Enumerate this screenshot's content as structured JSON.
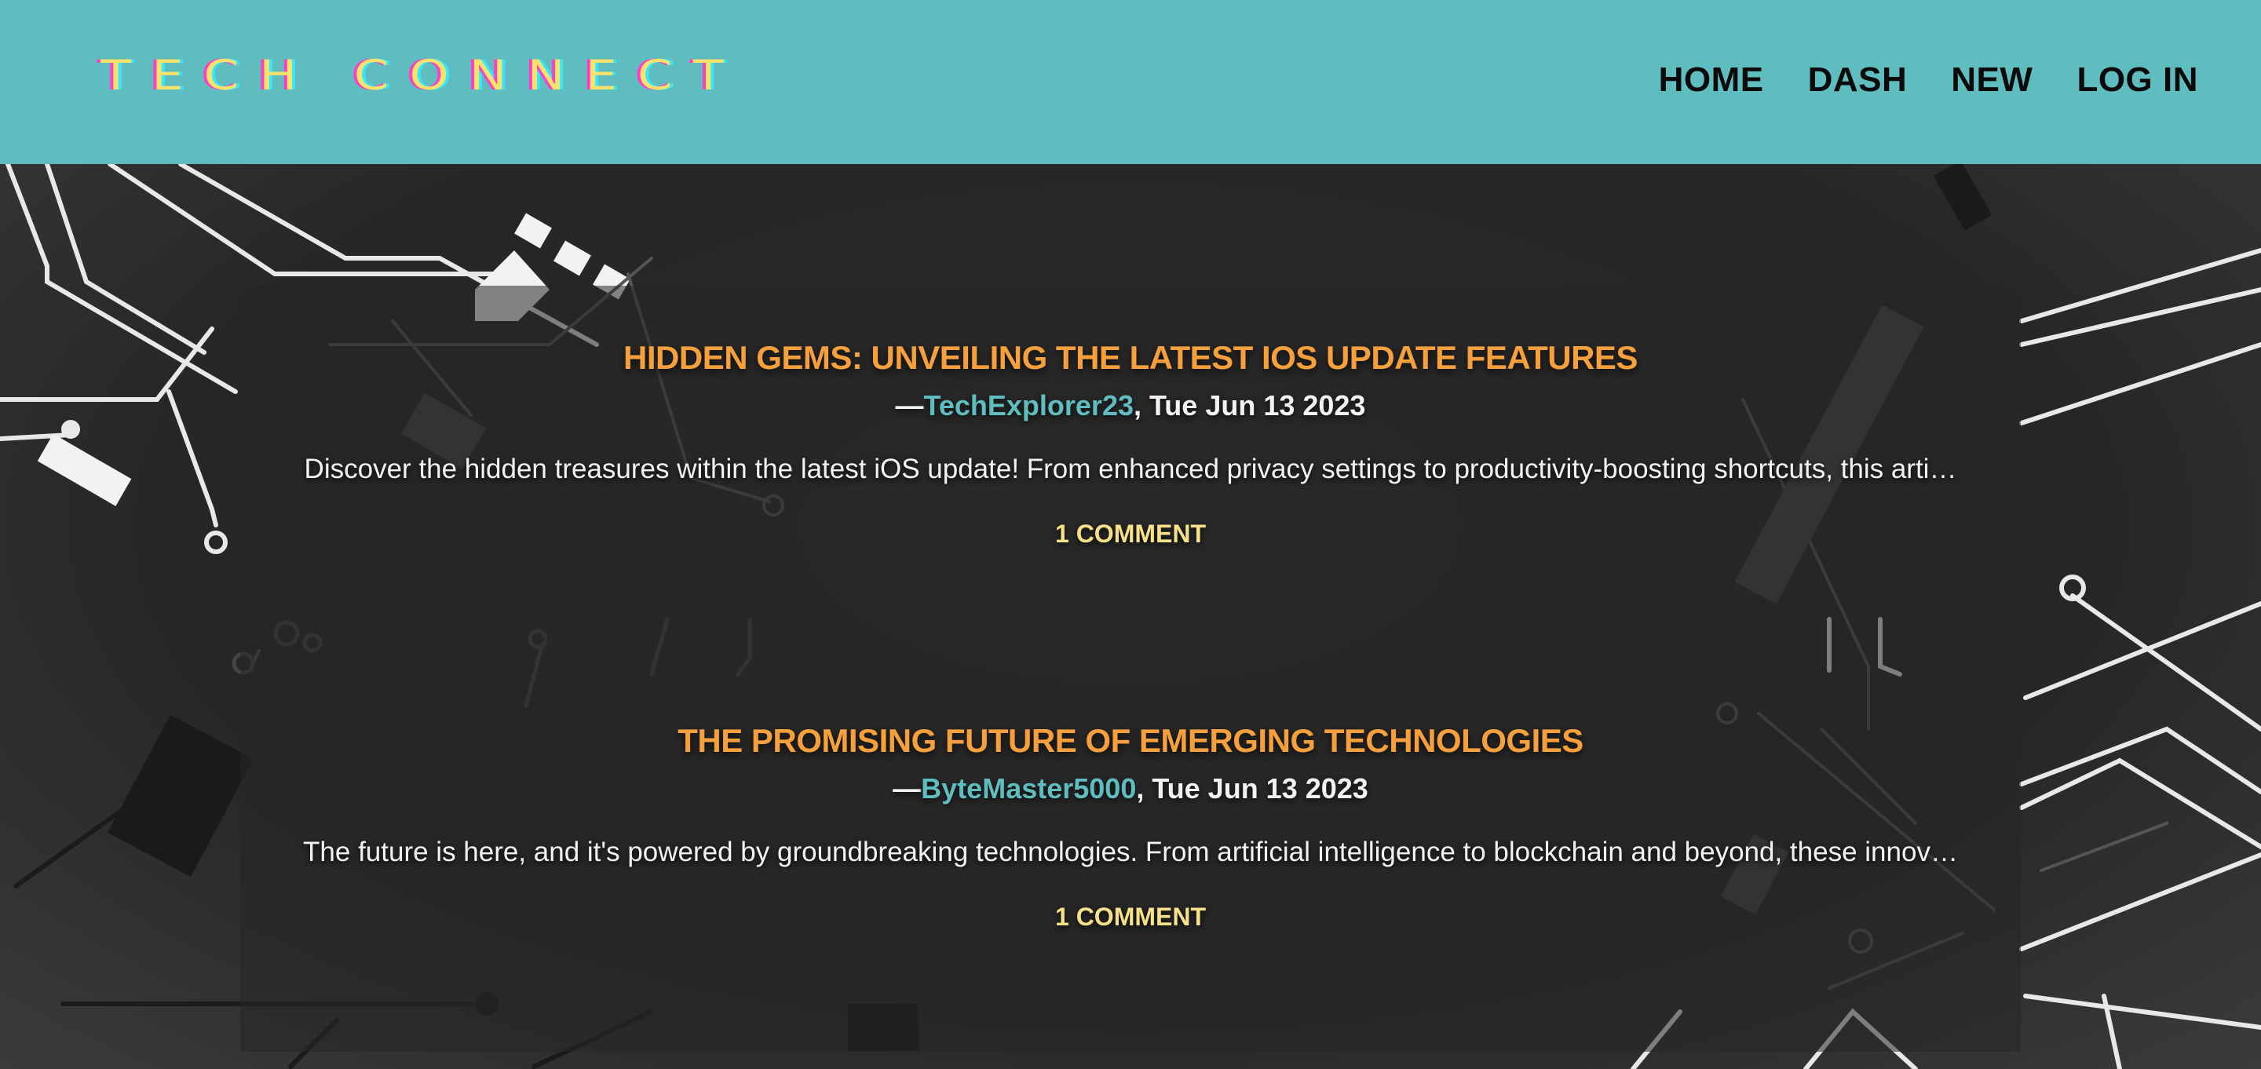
{
  "header": {
    "logo": "Tech Connect",
    "nav": [
      "HOME",
      "DASH",
      "NEW",
      "LOG IN"
    ]
  },
  "posts": [
    {
      "title": "HIDDEN GEMS: UNVEILING THE LATEST IOS UPDATE FEATURES",
      "dash": "—",
      "author": "TechExplorer23",
      "date": ", Tue Jun 13 2023",
      "excerpt": "Discover the hidden treasures within the latest iOS update! From enhanced privacy settings to productivity-boosting shortcuts, this arti…",
      "comments": "1 COMMENT"
    },
    {
      "title": "THE PROMISING FUTURE OF EMERGING TECHNOLOGIES",
      "dash": "—",
      "author": "ByteMaster5000",
      "date": ", Tue Jun 13 2023",
      "excerpt": "The future is here, and it's powered by groundbreaking technologies. From artificial intelligence to blockchain and beyond, these innov…",
      "comments": "1 COMMENT"
    }
  ],
  "colors": {
    "header_bg": "#5fbcbf",
    "title": "#f5a03c",
    "author": "#5fbcbf",
    "comments": "#f7e08a",
    "page_bg": "#2a2a2a"
  },
  "icons": {
    "background": "circuit-board-pattern"
  }
}
